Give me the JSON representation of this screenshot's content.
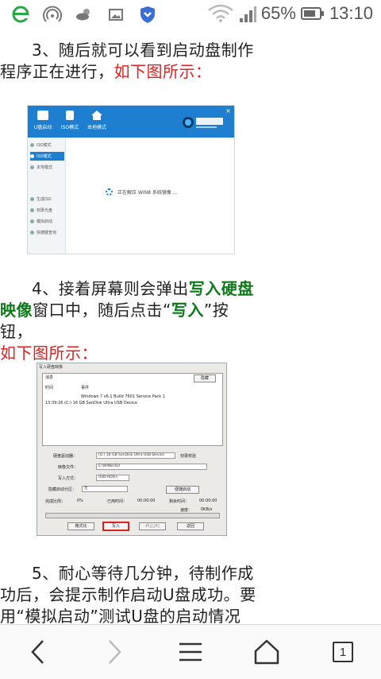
{
  "status_bar": {
    "battery": "65%",
    "time": "13:10",
    "icons": [
      "browser-e-icon",
      "wifi-hotspot-icon",
      "weather-icon",
      "image-icon",
      "shield-download-icon",
      "wifi-icon",
      "signal-icon",
      "battery-icon"
    ],
    "colors": {
      "browser_icon": "#27a845",
      "shield_icon": "#3b6fd6"
    }
  },
  "article": {
    "step3": {
      "text": "3、随后就可以看到启动盘制作程序正在进行，",
      "link": "如下图所示："
    },
    "figure1": {
      "tabs": [
        "U盘启动",
        "ISO模式",
        "本地模式"
      ],
      "sidebar": [
        "ISO模式",
        "ISO模式",
        "本地模式",
        "生成ISO",
        "刻录光盘",
        "模拟启动",
        "快捷键查询"
      ],
      "status": "正在解压 WIN8 系统镜像 ..."
    },
    "step4": {
      "pre": "4、接着屏幕则会弹出",
      "emph1": "写入硬盘映像",
      "mid": "窗口中，随后点击“",
      "emph2": "写入",
      "post": "”按钮，",
      "link": "如下图所示："
    },
    "figure2": {
      "title": "写入硬盘映像",
      "hide_button": "隐藏",
      "list_headers": [
        "消息",
        "时间",
        "事件"
      ],
      "list_row": [
        "Windows 7 v6.1 Build 7601 Service Pack 1",
        "13:39:26 (C:) 16 GB SanDisk Ultra USB Device"
      ],
      "labels": {
        "disk": "硬盘驱动器：",
        "image": "映像文件：",
        "write_mode": "写入方式：",
        "hide_partition": "隐藏启动分区：",
        "done": "完成比例：",
        "elapsed": "已用时间：",
        "remaining": "剩余时间：",
        "speed": "速度："
      },
      "values": {
        "disk": "(G:) 16 GB SanDisk Ultra USB Device",
        "verify": "刻录校验",
        "image": "E:\\WIN8.ISO",
        "write_mode": "USB-HDD+",
        "hide_partition": "无",
        "done": "0%",
        "elapsed": "00:00:00",
        "remaining": "00:00:00",
        "speed": "0KB/s"
      },
      "buttons": [
        "格式化",
        "写入",
        "终止[A]",
        "返回"
      ],
      "extra_button": "便捷启动",
      "highlight_color": "#e02020"
    },
    "step5": {
      "text": "5、耐心等待几分钟，待制作成功后，会提示制作启动U盘成功。要用“模拟启动”测试U盘的启动情况"
    }
  },
  "nav": {
    "items": [
      "back-icon",
      "forward-icon",
      "menu-icon",
      "home-icon",
      "tabs-icon"
    ],
    "tab_count": "1"
  }
}
